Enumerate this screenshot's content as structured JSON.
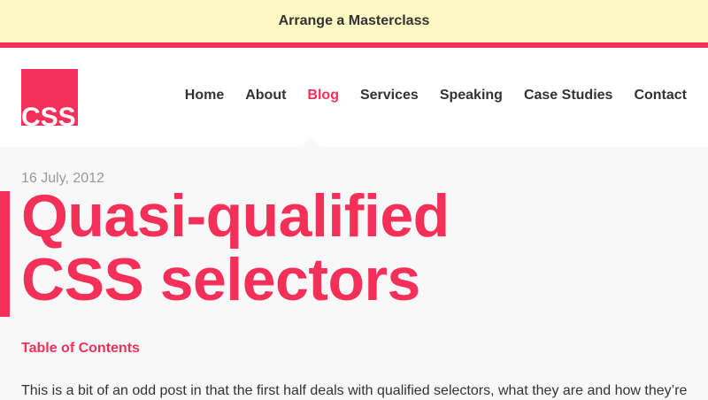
{
  "banner": {
    "label": "Arrange a Masterclass"
  },
  "logo": {
    "text": "CSS"
  },
  "nav": {
    "items": [
      {
        "label": "Home"
      },
      {
        "label": "About"
      },
      {
        "label": "Blog"
      },
      {
        "label": "Services"
      },
      {
        "label": "Speaking"
      },
      {
        "label": "Case Studies"
      },
      {
        "label": "Contact"
      }
    ],
    "active": "Blog"
  },
  "post": {
    "date": "16 July, 2012",
    "title_line1": "Quasi-qualified",
    "title_line2": "CSS selectors",
    "toc_label": "Table of Contents",
    "intro": "This is a bit of an odd post in that the first half deals with qualified selectors, what they are and how they’re"
  },
  "colors": {
    "accent": "#f43059",
    "banner_bg": "#fdf8c4",
    "page_bg": "#f8f8f8"
  }
}
